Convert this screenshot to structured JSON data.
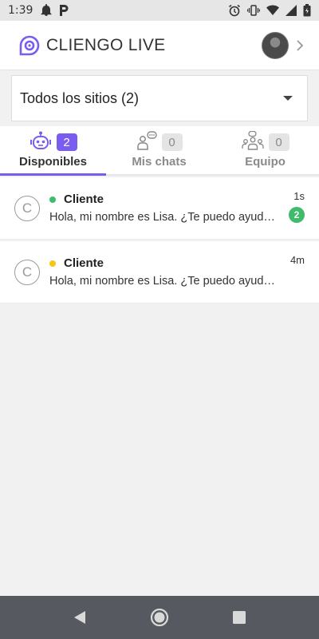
{
  "status_bar": {
    "time": "1:39",
    "left_icons": [
      "bell-icon",
      "p-icon"
    ],
    "right_icons": [
      "alarm-icon",
      "vibrate-icon",
      "wifi-icon",
      "signal-icon",
      "battery-icon"
    ]
  },
  "header": {
    "title": "CLIENGO LIVE",
    "logo_icon": "cliengo-logo-icon",
    "accent": "#7a5cf0"
  },
  "site_selector": {
    "label": "Todos los sitios (2)"
  },
  "tabs": [
    {
      "label": "Disponibles",
      "count": "2",
      "icon": "robot-icon",
      "active": true
    },
    {
      "label": "Mis chats",
      "count": "0",
      "icon": "agent-chat-icon",
      "active": false
    },
    {
      "label": "Equipo",
      "count": "0",
      "icon": "team-icon",
      "active": false
    }
  ],
  "chats": [
    {
      "avatar": "C",
      "name": "Cliente",
      "status_color": "#3fbb6b",
      "preview": "Hola, mi nombre es Lisa. ¿Te puedo ayudar?",
      "time": "1s",
      "unread": "2"
    },
    {
      "avatar": "C",
      "name": "Cliente",
      "status_color": "#f5c518",
      "preview": "Hola, mi nombre es Lisa. ¿Te puedo ayudar?",
      "time": "4m",
      "unread": null
    }
  ],
  "nav": [
    "back-icon",
    "home-icon",
    "recents-icon"
  ]
}
